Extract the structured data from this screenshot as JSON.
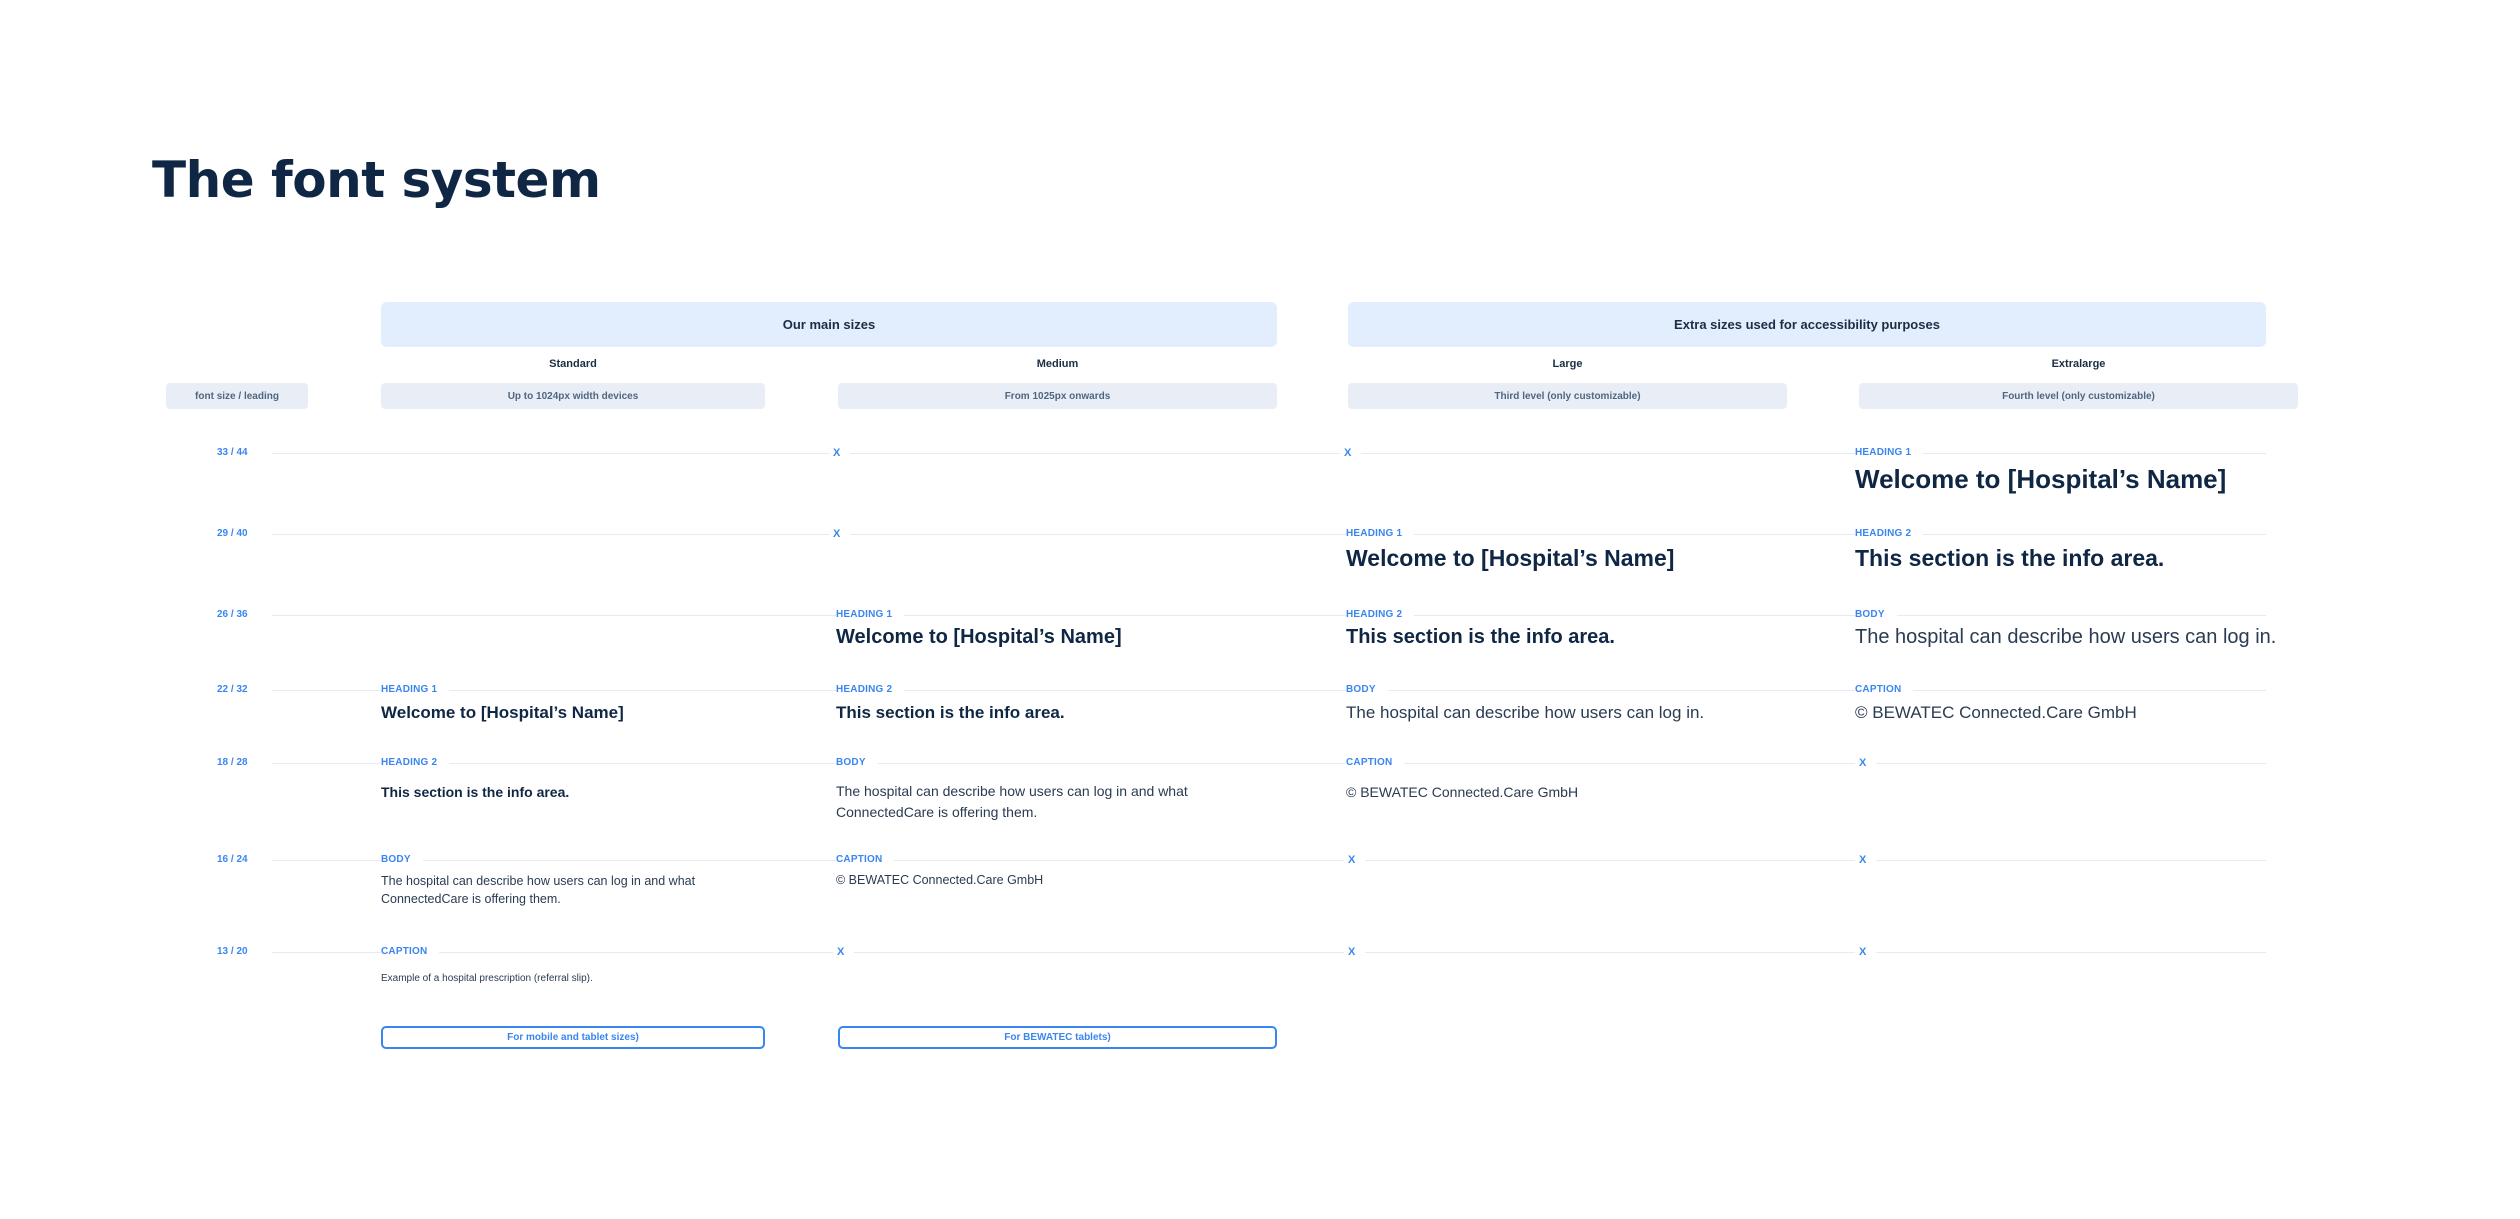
{
  "page": {
    "title": "The font system"
  },
  "groups": {
    "main": "Our main sizes",
    "extra": "Extra sizes used for accessibility purposes"
  },
  "columns": [
    {
      "name": "Standard",
      "subtitle": "Up to 1024px width devices"
    },
    {
      "name": "Medium",
      "subtitle": "From 1025px onwards"
    },
    {
      "name": "Large",
      "subtitle": "Third level (only customizable)"
    },
    {
      "name": "Extralarge",
      "subtitle": "Fourth level (only customizable)"
    }
  ],
  "row_header_label": "font size / leading",
  "rows": [
    {
      "size": "33 / 44"
    },
    {
      "size": "29 / 40"
    },
    {
      "size": "26 / 36"
    },
    {
      "size": "22 / 32"
    },
    {
      "size": "18 / 28"
    },
    {
      "size": "16 / 24"
    },
    {
      "size": "13 / 20"
    }
  ],
  "marker": "X",
  "tags": {
    "h1": "HEADING 1",
    "h2": "HEADING 2",
    "body": "BODY",
    "caption": "CAPTION"
  },
  "samples": {
    "heading1": "Welcome to [Hospital’s Name]",
    "heading2": "This section is the info area.",
    "body_short": "The hospital can describe how users can log in.",
    "body_long": "The hospital can describe how users can log in and what ConnectedCare is offering them.",
    "caption_copyright": "© BEWATEC Connected.Care GmbH",
    "caption_example": "Example of a hospital prescription (referral slip)."
  },
  "buttons": {
    "mobile": "For mobile and tablet sizes)",
    "tablets": "For BEWATEC tablets)"
  }
}
